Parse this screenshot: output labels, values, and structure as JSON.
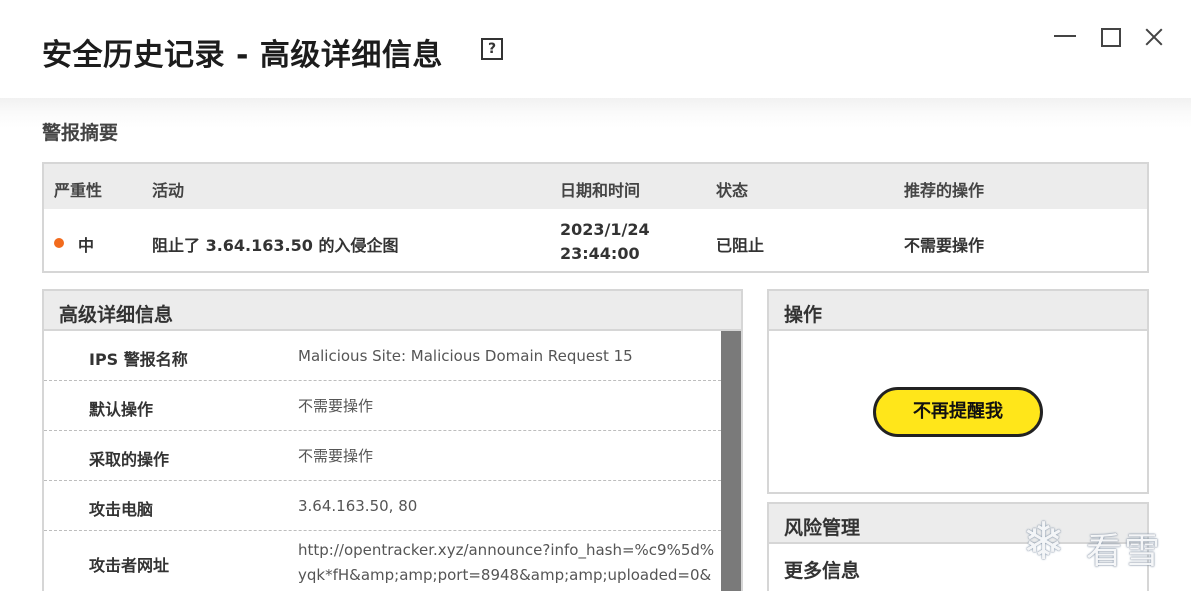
{
  "window": {
    "title": "安全历史记录 - 高级详细信息",
    "help_glyph": "?"
  },
  "summary": {
    "label": "警报摘要",
    "columns": [
      "严重性",
      "活动",
      "日期和时间",
      "状态",
      "推荐的操作"
    ],
    "row": {
      "severity": "中",
      "severity_color": "#f26b1d",
      "activity": "阻止了 3.64.163.50 的入侵企图",
      "date": "2023/1/24",
      "time": "23:44:00",
      "status": "已阻止",
      "recommended": "不需要操作"
    }
  },
  "details": {
    "title": "高级详细信息",
    "rows": [
      {
        "key": "IPS 警报名称",
        "value": "Malicious Site: Malicious Domain Request 15"
      },
      {
        "key": "默认操作",
        "value": "不需要操作"
      },
      {
        "key": "采取的操作",
        "value": "不需要操作"
      },
      {
        "key": "攻击电脑",
        "value": "3.64.163.50, 80"
      },
      {
        "key": "攻击者网址",
        "value_lines": [
          "http://opentracker.xyz/announce?info_hash=%c9%5d%",
          "yqk*fH&amp;amp;port=8948&amp;amp;uploaded=0&"
        ]
      }
    ]
  },
  "actions": {
    "title": "操作",
    "button": "不再提醒我",
    "button_color": "#ffe61a"
  },
  "risk": {
    "title": "风险管理",
    "more": "更多信息"
  },
  "watermark": {
    "glyph": "❄",
    "text": "看雪"
  }
}
